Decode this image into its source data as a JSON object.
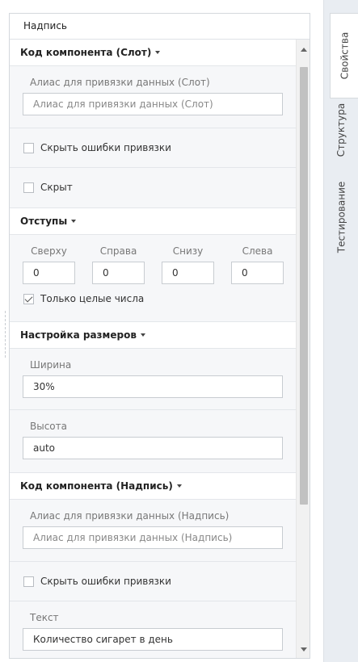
{
  "panel": {
    "title": "Надпись"
  },
  "slot_section": {
    "header": "Код компонента (Слот)",
    "alias_label": "Алиас для привязки данных (Слот)",
    "alias_placeholder": "Алиас для привязки данных (Слот)",
    "hide_errors_label": "Скрыть ошибки привязки",
    "hide_errors_checked": false,
    "hidden_label": "Скрыт",
    "hidden_checked": false
  },
  "padding_section": {
    "header": "Отступы",
    "fields": [
      {
        "label": "Сверху",
        "value": "0"
      },
      {
        "label": "Справа",
        "value": "0"
      },
      {
        "label": "Снизу",
        "value": "0"
      },
      {
        "label": "Слева",
        "value": "0"
      }
    ],
    "integers_only_label": "Только целые числа",
    "integers_only_checked": true
  },
  "size_section": {
    "header": "Настройка размеров",
    "width_label": "Ширина",
    "width_value": "30%",
    "height_label": "Высота",
    "height_value": "auto"
  },
  "label_section": {
    "header": "Код компонента (Надпись)",
    "alias_label": "Алиас для привязки данных (Надпись)",
    "alias_placeholder": "Алиас для привязки данных (Надпись)",
    "hide_errors_label": "Скрыть ошибки привязки",
    "hide_errors_checked": false,
    "text_label": "Текст",
    "text_value": "Количество сигарет в день"
  },
  "tabs": [
    {
      "label": "Свойства",
      "active": true
    },
    {
      "label": "Структура",
      "active": false
    },
    {
      "label": "Тестирование",
      "active": false
    }
  ]
}
